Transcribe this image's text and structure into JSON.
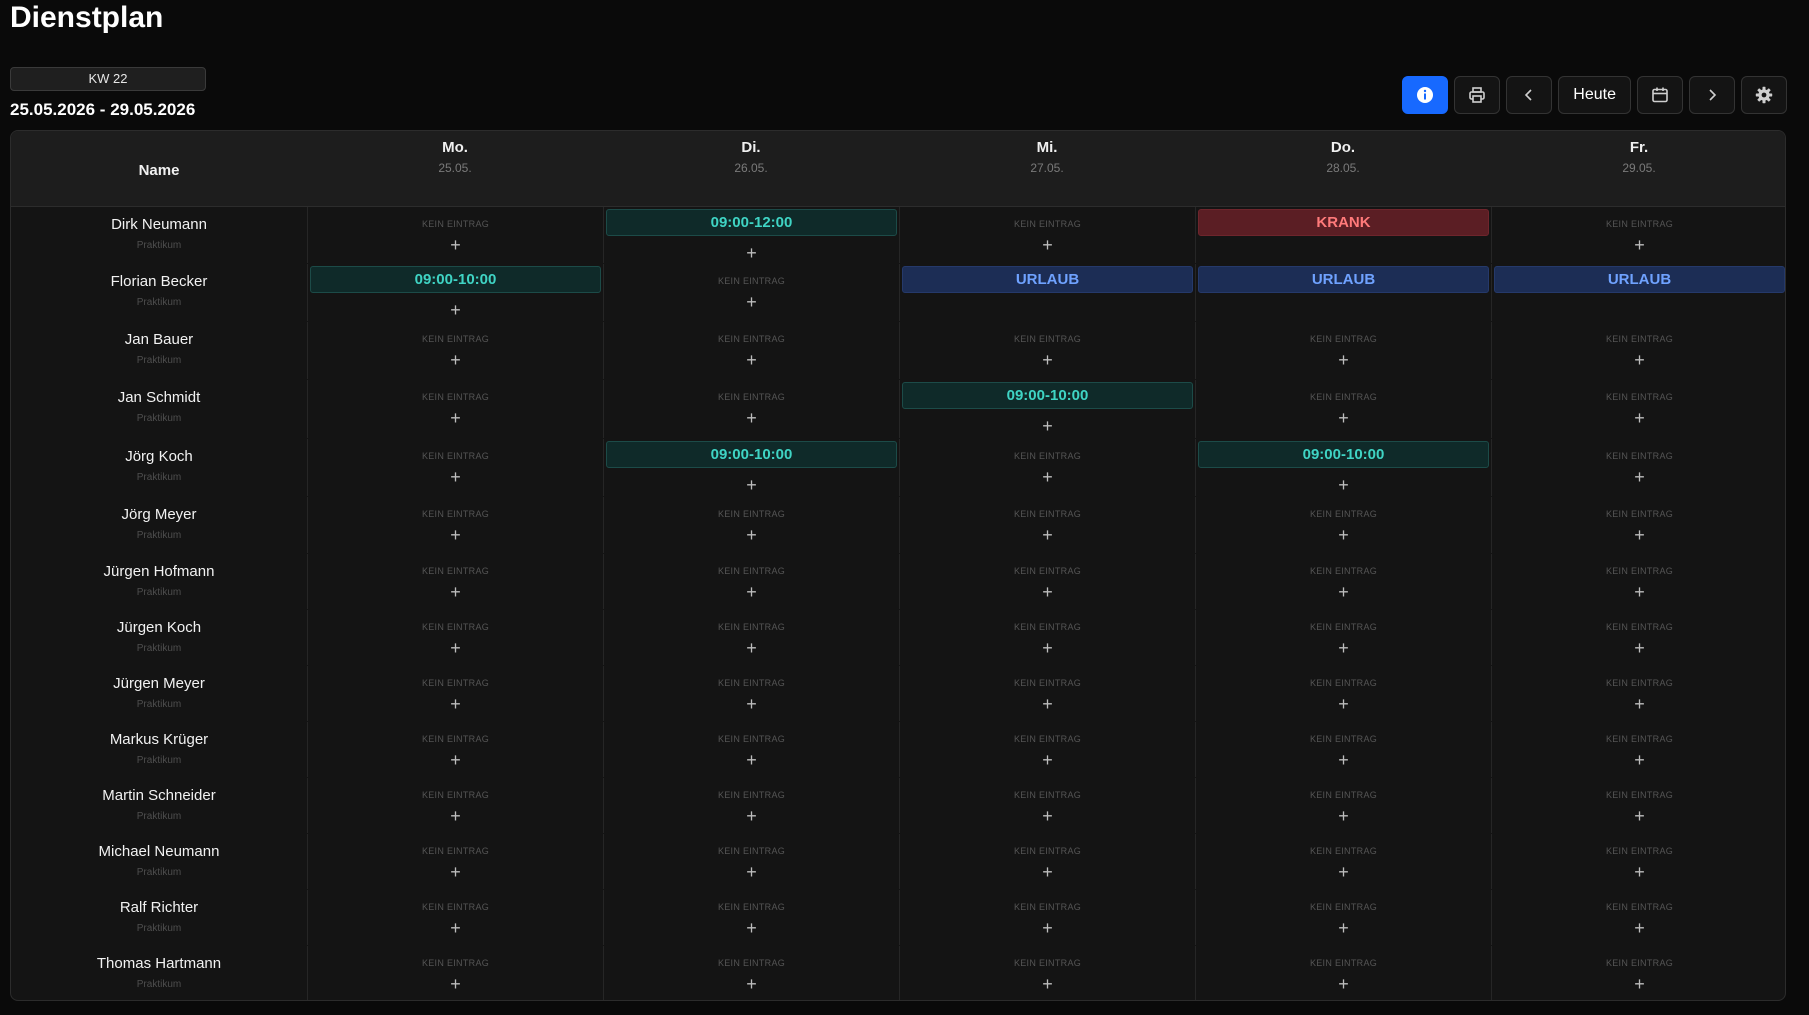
{
  "title": "Dienstplan",
  "week_badge": "KW 22",
  "date_range": "25.05.2026 - 29.05.2026",
  "toolbar": {
    "info_icon": "info-icon",
    "print_icon": "printer-icon",
    "prev_icon": "chevron-left-icon",
    "today_label": "Heute",
    "calendar_icon": "calendar-icon",
    "next_icon": "chevron-right-icon",
    "settings_icon": "gear-icon"
  },
  "table": {
    "name_header": "Name",
    "empty_label": "KEIN EINTRAG",
    "add_symbol": "+",
    "days": [
      {
        "label": "Mo.",
        "date": "25.05."
      },
      {
        "label": "Di.",
        "date": "26.05."
      },
      {
        "label": "Mi.",
        "date": "27.05."
      },
      {
        "label": "Do.",
        "date": "28.05."
      },
      {
        "label": "Fr.",
        "date": "29.05."
      }
    ],
    "rows": [
      {
        "name": "Dirk Neumann",
        "role": "Praktikum",
        "cells": [
          null,
          {
            "type": "shift",
            "text": "09:00-12:00"
          },
          null,
          {
            "type": "krank",
            "text": "KRANK"
          },
          null
        ]
      },
      {
        "name": "Florian Becker",
        "role": "Praktikum",
        "cells": [
          {
            "type": "shift",
            "text": "09:00-10:00"
          },
          null,
          {
            "type": "urlaub",
            "text": "URLAUB"
          },
          {
            "type": "urlaub",
            "text": "URLAUB"
          },
          {
            "type": "urlaub",
            "text": "URLAUB"
          }
        ]
      },
      {
        "name": "Jan Bauer",
        "role": "Praktikum",
        "cells": [
          null,
          null,
          null,
          null,
          null
        ]
      },
      {
        "name": "Jan Schmidt",
        "role": "Praktikum",
        "cells": [
          null,
          null,
          {
            "type": "shift",
            "text": "09:00-10:00"
          },
          null,
          null
        ]
      },
      {
        "name": "Jörg Koch",
        "role": "Praktikum",
        "cells": [
          null,
          {
            "type": "shift",
            "text": "09:00-10:00"
          },
          null,
          {
            "type": "shift",
            "text": "09:00-10:00"
          },
          null
        ]
      },
      {
        "name": "Jörg Meyer",
        "role": "Praktikum",
        "cells": [
          null,
          null,
          null,
          null,
          null
        ]
      },
      {
        "name": "Jürgen Hofmann",
        "role": "Praktikum",
        "cells": [
          null,
          null,
          null,
          null,
          null
        ]
      },
      {
        "name": "Jürgen Koch",
        "role": "Praktikum",
        "cells": [
          null,
          null,
          null,
          null,
          null
        ]
      },
      {
        "name": "Jürgen Meyer",
        "role": "Praktikum",
        "cells": [
          null,
          null,
          null,
          null,
          null
        ]
      },
      {
        "name": "Markus Krüger",
        "role": "Praktikum",
        "cells": [
          null,
          null,
          null,
          null,
          null
        ]
      },
      {
        "name": "Martin Schneider",
        "role": "Praktikum",
        "cells": [
          null,
          null,
          null,
          null,
          null
        ]
      },
      {
        "name": "Michael Neumann",
        "role": "Praktikum",
        "cells": [
          null,
          null,
          null,
          null,
          null
        ]
      },
      {
        "name": "Ralf Richter",
        "role": "Praktikum",
        "cells": [
          null,
          null,
          null,
          null,
          null
        ]
      },
      {
        "name": "Thomas Hartmann",
        "role": "Praktikum",
        "cells": [
          null,
          null,
          null,
          null,
          null
        ]
      }
    ]
  },
  "colors": {
    "shift": "#3fd4c4",
    "krank": "#ff7a7a",
    "urlaub": "#6fa2ff",
    "accent": "#1769ff"
  }
}
